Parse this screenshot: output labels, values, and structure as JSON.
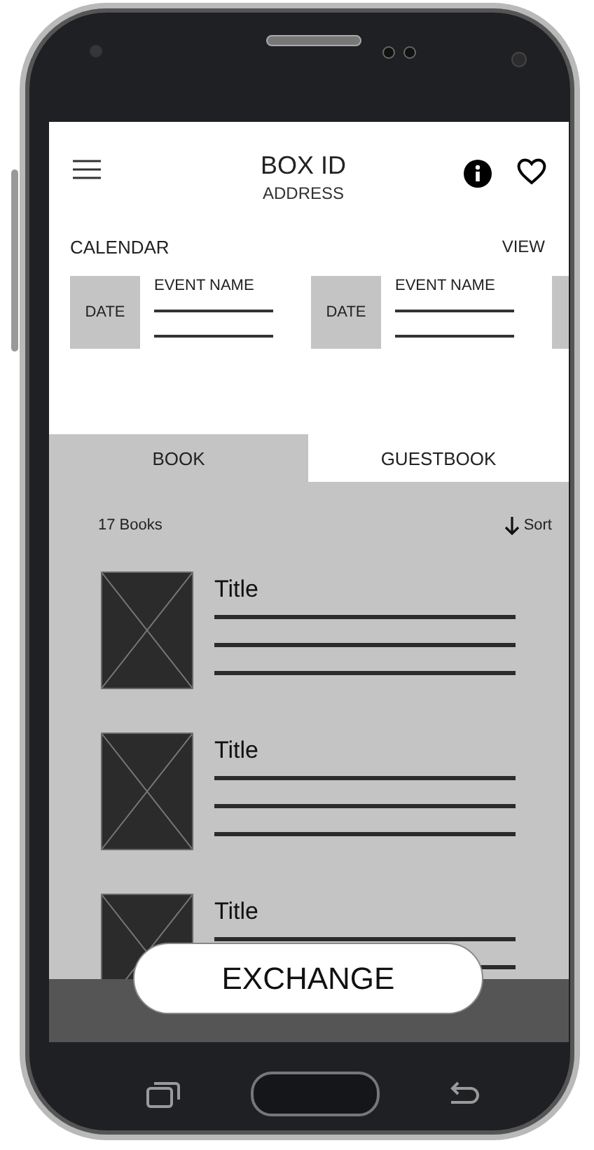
{
  "header": {
    "title": "BOX ID",
    "subtitle": "ADDRESS"
  },
  "calendar": {
    "label": "CALENDAR",
    "action": "VIEW",
    "events": [
      {
        "date": "DATE",
        "name": "EVENT NAME"
      },
      {
        "date": "DATE",
        "name": "EVENT NAME"
      }
    ]
  },
  "tabs": [
    {
      "label": "BOOK",
      "selected": true
    },
    {
      "label": "GUESTBOOK",
      "selected": false
    }
  ],
  "books": {
    "count": "17 Books",
    "sort": "Sort",
    "items": [
      {
        "title": "Title"
      },
      {
        "title": "Title"
      },
      {
        "title": "Title"
      }
    ]
  },
  "exchange_button": "EXCHANGE"
}
